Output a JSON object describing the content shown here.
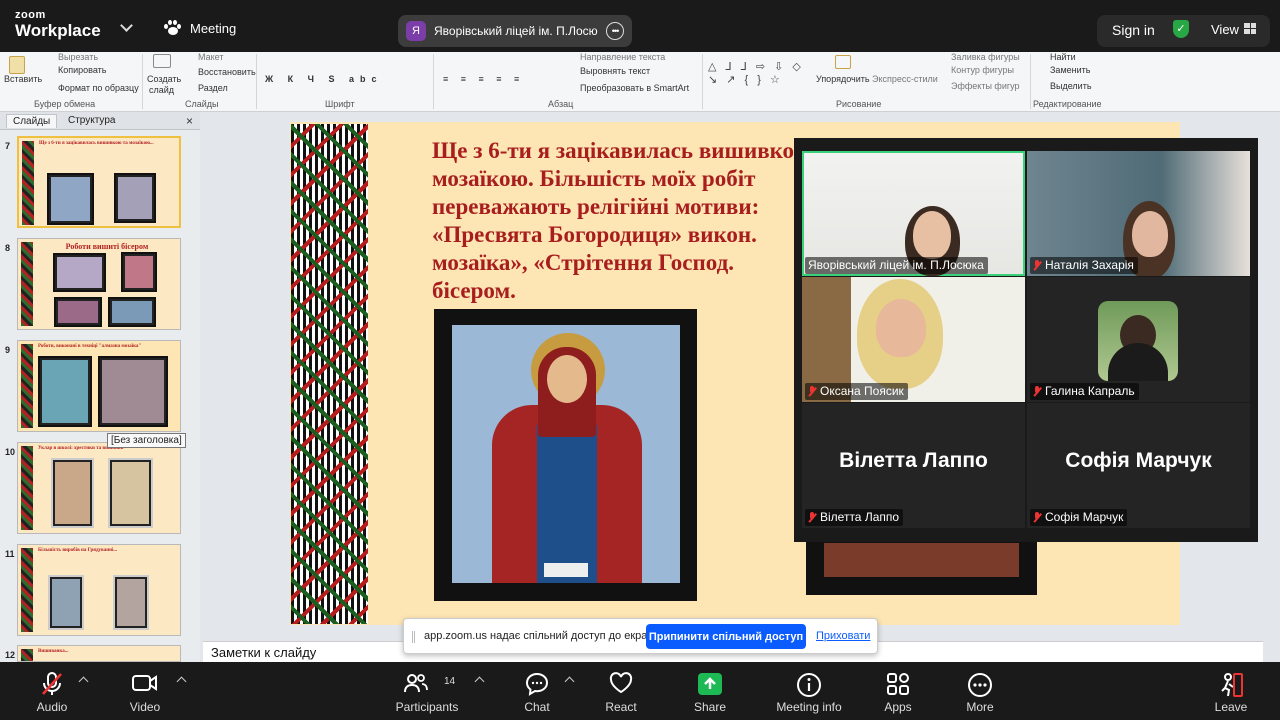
{
  "app": {
    "brand_line1": "zoom",
    "brand_line2": "Workplace",
    "meeting_label": "Meeting",
    "active_speaker_initial": "Я",
    "active_speaker_name": "Яворівський ліцей ім. П.Лосюка",
    "sign_in": "Sign in",
    "view": "View"
  },
  "ribbon": {
    "clipboard": {
      "paste": "Вставить",
      "cut": "Вырезать",
      "copy": "Копировать",
      "format_painter": "Формат по образцу",
      "group": "Буфер обмена"
    },
    "slides": {
      "create": "Создать",
      "create2": "слайд",
      "layout": "Макет",
      "restore": "Восстановить",
      "section": "Раздел",
      "group": "Слайды"
    },
    "font": {
      "group": "Шрифт"
    },
    "paragraph": {
      "text_direction": "Направление текста",
      "align_text": "Выровнять текст",
      "smartart": "Преобразовать в SmartArt",
      "group": "Абзац"
    },
    "drawing": {
      "arrange": "Упорядочить",
      "quick_styles": "Экспресс-стили",
      "fill": "Заливка фигуры",
      "outline": "Контур фигуры",
      "effects": "Эффекты фигур",
      "group": "Рисование"
    },
    "editing": {
      "find": "Найти",
      "replace": "Заменить",
      "select": "Выделить",
      "group": "Редактирование"
    }
  },
  "slides_panel": {
    "tab_slides": "Слайды",
    "tab_outline": "Структура",
    "close": "×",
    "tooltip": "[Без заголовка]",
    "thumbs": [
      {
        "num": "7",
        "title": "Ще з 6-ти я зацікавилась вишивкою та мозаїкою..."
      },
      {
        "num": "8",
        "title": "Роботи вишиті бісером"
      },
      {
        "num": "9",
        "title": "Роботи, виконані в техніці \"алмазна мозаїка\""
      },
      {
        "num": "10",
        "title": "Уклар в школі: хрестики та вишивки"
      },
      {
        "num": "11",
        "title": "Більшість виробів на Грядуванні..."
      },
      {
        "num": "12",
        "title": "Вишиванка..."
      }
    ]
  },
  "slide": {
    "lines": [
      "Ще з 6-ти я зацікавилась вишивкою та",
      "мозаїкою. Більшість моїх робіт",
      "переважають релігійні мотиви:",
      "«Пресвята Богородиця» викон.",
      "мозаїка», «Стрітення Господ.",
      "бісером."
    ]
  },
  "participants": [
    {
      "name": "Яворівський ліцей ім. П.Лосюка",
      "muted": false,
      "active": true
    },
    {
      "name": "Наталія Захарія",
      "muted": true
    },
    {
      "name": "Оксана Поясик",
      "muted": true
    },
    {
      "name": "Галина Капраль",
      "muted": true
    },
    {
      "name": "Вілетта Лаппо",
      "muted": true,
      "display": "Вілетта Лаппо"
    },
    {
      "name": "Софія Марчук",
      "muted": true,
      "display": "Софія Марчук"
    }
  ],
  "share_banner": {
    "text": "app.zoom.us надає спільний доступ до екрана.",
    "stop": "Припинити спільний доступ",
    "hide": "Приховати"
  },
  "notes_placeholder": "Заметки к слайду",
  "toolbar": {
    "audio": "Audio",
    "video": "Video",
    "participants": "Participants",
    "participants_count": "14",
    "chat": "Chat",
    "react": "React",
    "share": "Share",
    "meeting_info": "Meeting info",
    "apps": "Apps",
    "more": "More",
    "leave": "Leave"
  },
  "colors": {
    "share_green": "#1db954",
    "active_outline": "#3bd07a",
    "primary_blue": "#0b5cff",
    "slide_text": "#a81e1e"
  }
}
